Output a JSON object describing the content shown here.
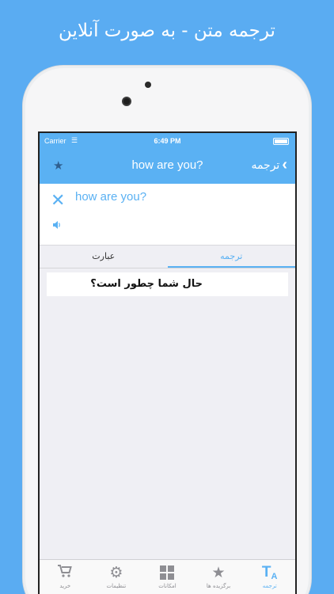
{
  "promo": {
    "headline": "ترجمه متن - به صورت آنلاین"
  },
  "status_bar": {
    "carrier": "Carrier",
    "time": "6:49 PM"
  },
  "nav": {
    "title": "how are you?",
    "back_label": "ترجمه",
    "favorite_icon": "star-icon",
    "back_icon": "chevron-right-icon"
  },
  "input": {
    "text": "how are you?",
    "clear_icon": "close-icon",
    "speak_icon": "speaker-icon"
  },
  "tabs": [
    {
      "label": "عبارت",
      "active": false
    },
    {
      "label": "ترجمه",
      "active": true
    }
  ],
  "result": {
    "text": "حال شما چطور است؟"
  },
  "tabbar": [
    {
      "label": "خرید",
      "icon": "cart-icon"
    },
    {
      "label": "تنظیمات",
      "icon": "gear-icon"
    },
    {
      "label": "امکانات",
      "icon": "grid-icon"
    },
    {
      "label": "برگزیده ها",
      "icon": "star-icon"
    },
    {
      "label": "ترجمه",
      "icon": "translate-icon",
      "active": true
    }
  ],
  "colors": {
    "accent": "#5ab1f3",
    "background": "#5aacf2",
    "inactive": "#8e8e93"
  }
}
